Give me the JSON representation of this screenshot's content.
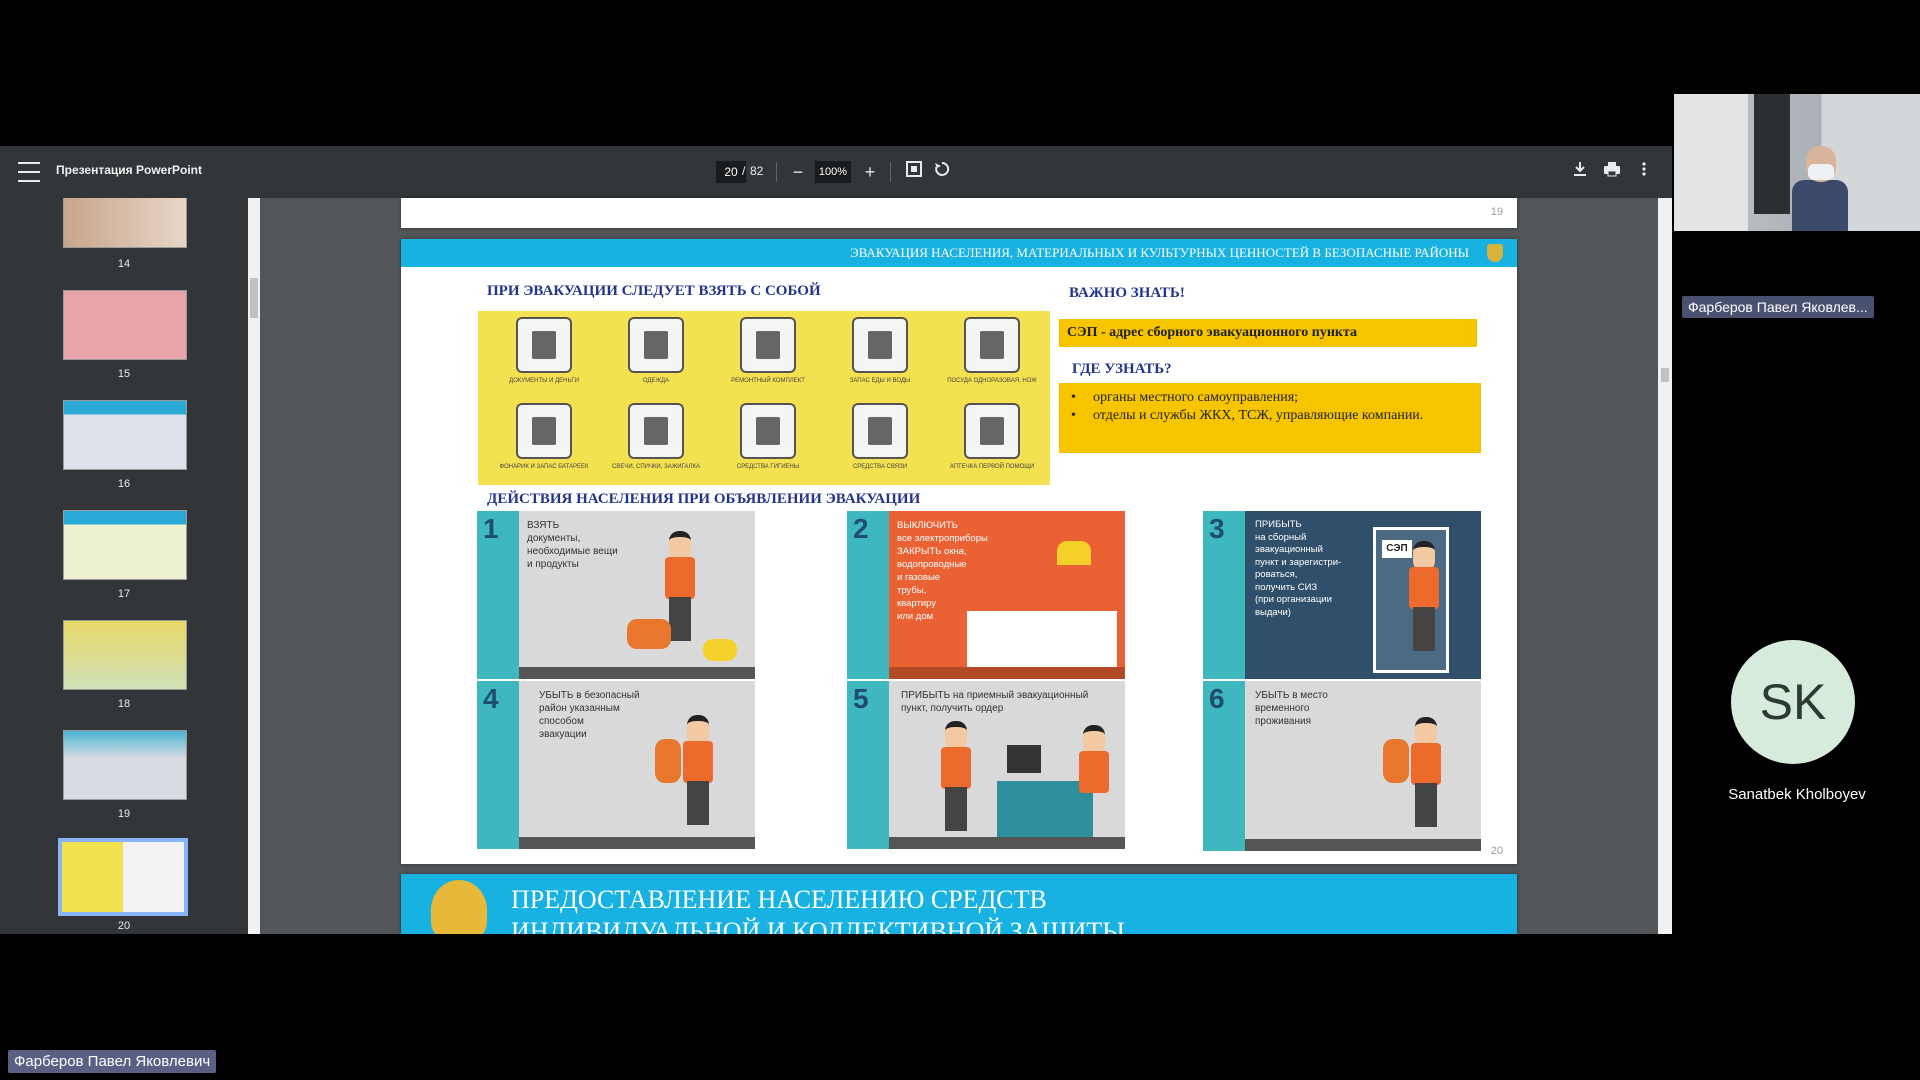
{
  "viewer": {
    "title": "Презентация PowerPoint",
    "page_current": "20",
    "page_sep": "/",
    "page_total": "82",
    "zoom": "100%",
    "zoom_out": "−",
    "zoom_in": "+",
    "icons": [
      "menu-icon",
      "zoom-out-icon",
      "zoom-in-icon",
      "fit-page-icon",
      "rotate-icon",
      "download-icon",
      "print-icon",
      "more-icon"
    ]
  },
  "thumbnails": [
    {
      "num": "14"
    },
    {
      "num": "15"
    },
    {
      "num": "16"
    },
    {
      "num": "17"
    },
    {
      "num": "18"
    },
    {
      "num": "19"
    },
    {
      "num": "20"
    }
  ],
  "pages": {
    "prev_page_num": "19",
    "slide": {
      "banner": "ЭВАКУАЦИЯ НАСЕЛЕНИЯ, МАТЕРИАЛЬНЫХ И КУЛЬТУРНЫХ ЦЕННОСТЕЙ В БЕЗОПАСНЫЕ РАЙОНЫ",
      "take_heading": "ПРИ ЭВАКУАЦИИ СЛЕДУЕТ ВЗЯТЬ С СОБОЙ",
      "items": [
        {
          "cap": "ДОКУМЕНТЫ И ДЕНЬГИ"
        },
        {
          "cap": "ОДЕЖДА"
        },
        {
          "cap": "РЕМОНТНЫЙ КОМПЛЕКТ"
        },
        {
          "cap": "ЗАПАС ЕДЫ И ВОДЫ"
        },
        {
          "cap": "ПОСУДА ОДНОРАЗОВАЯ, НОЖ"
        },
        {
          "cap": "ФОНАРИК И ЗАПАС БАТАРЕЕК"
        },
        {
          "cap": "СВЕЧИ, СПИЧКИ, ЗАЖИГАЛКА"
        },
        {
          "cap": "СРЕДСТВА ГИГИЕНЫ"
        },
        {
          "cap": "СРЕДСТВА СВЯЗИ"
        },
        {
          "cap": "АПТЕЧКА ПЕРВОЙ ПОМОЩИ"
        }
      ],
      "know_heading": "ВАЖНО ЗНАТЬ!",
      "sep_text": "СЭП - адрес сборного эвакуационного пункта",
      "where_heading": "ГДЕ УЗНАТЬ?",
      "where_items": [
        "органы местного самоуправления;",
        "отделы и службы ЖКХ, ТСЖ, управляющие компании."
      ],
      "actions_heading": "ДЕЙСТВИЯ НАСЕЛЕНИЯ ПРИ ОБЪЯВЛЕНИИ ЭВАКУАЦИИ",
      "steps": [
        {
          "num": "1",
          "text": "ВЗЯТЬ\nдокументы,\nнеобходимые вещи\nи продукты"
        },
        {
          "num": "2",
          "text": "ВЫКЛЮЧИТЬ\nвсе электроприборы\nЗАКРЫТЬ окна,\nводопроводные\nи газовые\nтрубы,\nквартиру\nили дом"
        },
        {
          "num": "3",
          "text": "ПРИБЫТЬ\nна сборный\nэвакуационный\nпункт и зарегистри-\nроваться,\nполучить СИЗ\n(при организации\nвыдачи)"
        },
        {
          "num": "4",
          "text": "УБЫТЬ в безопасный\nрайон указанным\nспособом\nэвакуации"
        },
        {
          "num": "5",
          "text": "ПРИБЫТЬ на приемный эвакуационный\nпункт, получить ордер"
        },
        {
          "num": "6",
          "text": "УБЫТЬ в место\nвременного\nпроживания"
        }
      ],
      "sep_door_label": "СЭП",
      "page_num": "20"
    },
    "next_title": "ПРЕДОСТАВЛЕНИЕ НАСЕЛЕНИЮ СРЕДСТВ",
    "next_title_2": "ИНДИВИДУАЛЬНОЙ И КОЛЛЕКТИВНОЙ ЗАЩИТЫ"
  },
  "participants": {
    "video_name": "Фарберов Павел Яковлев...",
    "avatar_initials": "SK",
    "avatar_name": "Sanatbek Kholboyev",
    "presenter_name": "Фарберов Павел Яковлевич"
  },
  "colors": {
    "banner": "#17b2e2",
    "yellow": "#f4e14f",
    "teal": "#3fb7bf",
    "orange": "#ec6a2c"
  }
}
